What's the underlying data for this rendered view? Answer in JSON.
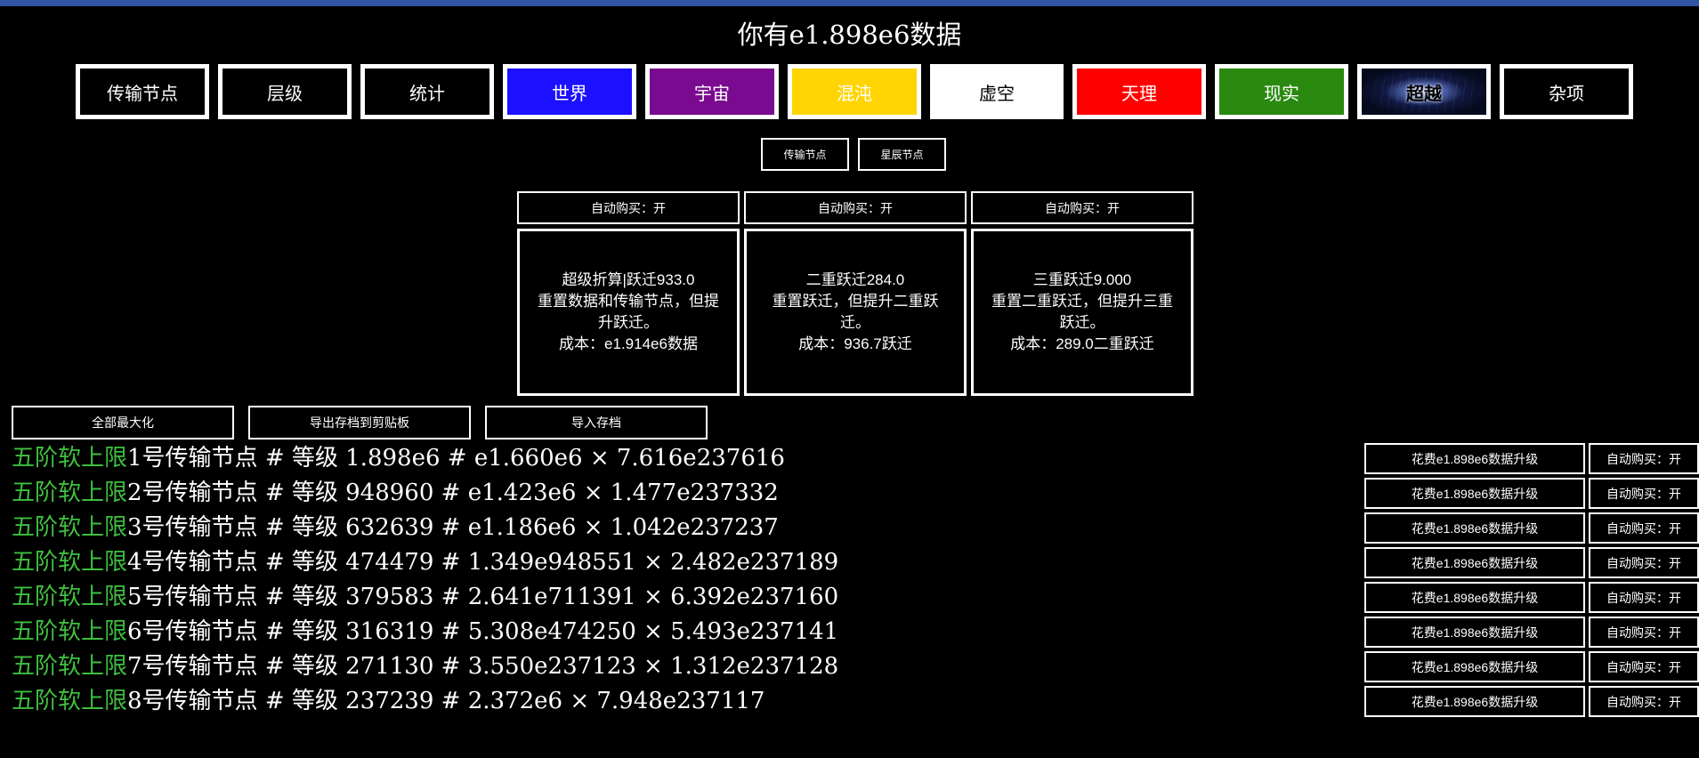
{
  "header": {
    "title": "你有e1.898e6数据"
  },
  "tabs": [
    {
      "label": "传输节点",
      "bg": "#000000",
      "color": "#ffffff"
    },
    {
      "label": "层级",
      "bg": "#000000",
      "color": "#ffffff"
    },
    {
      "label": "统计",
      "bg": "#000000",
      "color": "#ffffff"
    },
    {
      "label": "世界",
      "bg": "#1b10ff",
      "color": "#ffffff"
    },
    {
      "label": "宇宙",
      "bg": "#7a0a8f",
      "color": "#ffffff"
    },
    {
      "label": "混沌",
      "bg": "#ffd400",
      "color": "#ffffff"
    },
    {
      "label": "虚空",
      "bg": "#ffffff",
      "color": "#000000"
    },
    {
      "label": "天理",
      "bg": "#ff0000",
      "color": "#ffffff"
    },
    {
      "label": "现实",
      "bg": "#2a8a10",
      "color": "#ffffff"
    },
    {
      "label": "超越",
      "bg": "hyper",
      "color": "#000000"
    },
    {
      "label": "杂项",
      "bg": "#000000",
      "color": "#ffffff"
    }
  ],
  "subtabs": [
    {
      "label": "传输节点"
    },
    {
      "label": "星辰节点"
    }
  ],
  "prestige": [
    {
      "auto": "自动购买：开",
      "title": "超级折算|跃迁933.0",
      "desc": "重置数据和传输节点，但提升跃迁。",
      "cost": "成本：e1.914e6数据"
    },
    {
      "auto": "自动购买：开",
      "title": "二重跃迁284.0",
      "desc": "重置跃迁，但提升二重跃迁。",
      "cost": "成本：936.7跃迁"
    },
    {
      "auto": "自动购买：开",
      "title": "三重跃迁9.000",
      "desc": "重置二重跃迁，但提升三重跃迁。",
      "cost": "成本：289.0二重跃迁"
    }
  ],
  "actions": {
    "max_all": "全部最大化",
    "export": "导出存档到剪贴板",
    "import": "导入存档"
  },
  "nodes": [
    {
      "soft": "五阶软上限",
      "text": "1号传输节点 # 等级 1.898e6 # e1.660e6 × 7.616e237616",
      "upgrade": "花费e1.898e6数据升级",
      "auto": "自动购买：开"
    },
    {
      "soft": "五阶软上限",
      "text": "2号传输节点 # 等级 948960 # e1.423e6 × 1.477e237332",
      "upgrade": "花费e1.898e6数据升级",
      "auto": "自动购买：开"
    },
    {
      "soft": "五阶软上限",
      "text": "3号传输节点 # 等级 632639 # e1.186e6 × 1.042e237237",
      "upgrade": "花费e1.898e6数据升级",
      "auto": "自动购买：开"
    },
    {
      "soft": "五阶软上限",
      "text": "4号传输节点 # 等级 474479 # 1.349e948551 × 2.482e237189",
      "upgrade": "花费e1.898e6数据升级",
      "auto": "自动购买：开"
    },
    {
      "soft": "五阶软上限",
      "text": "5号传输节点 # 等级 379583 # 2.641e711391 × 6.392e237160",
      "upgrade": "花费e1.898e6数据升级",
      "auto": "自动购买：开"
    },
    {
      "soft": "五阶软上限",
      "text": "6号传输节点 # 等级 316319 # 5.308e474250 × 5.493e237141",
      "upgrade": "花费e1.898e6数据升级",
      "auto": "自动购买：开"
    },
    {
      "soft": "五阶软上限",
      "text": "7号传输节点 # 等级 271130 # 3.550e237123 × 1.312e237128",
      "upgrade": "花费e1.898e6数据升级",
      "auto": "自动购买：开"
    },
    {
      "soft": "五阶软上限",
      "text": "8号传输节点 # 等级 237239 # 2.372e6 × 7.948e237117",
      "upgrade": "花费e1.898e6数据升级",
      "auto": "自动购买：开"
    }
  ],
  "colors": {
    "soft_cap": "#3fbf3f",
    "top_bar": "#2f55a4"
  }
}
